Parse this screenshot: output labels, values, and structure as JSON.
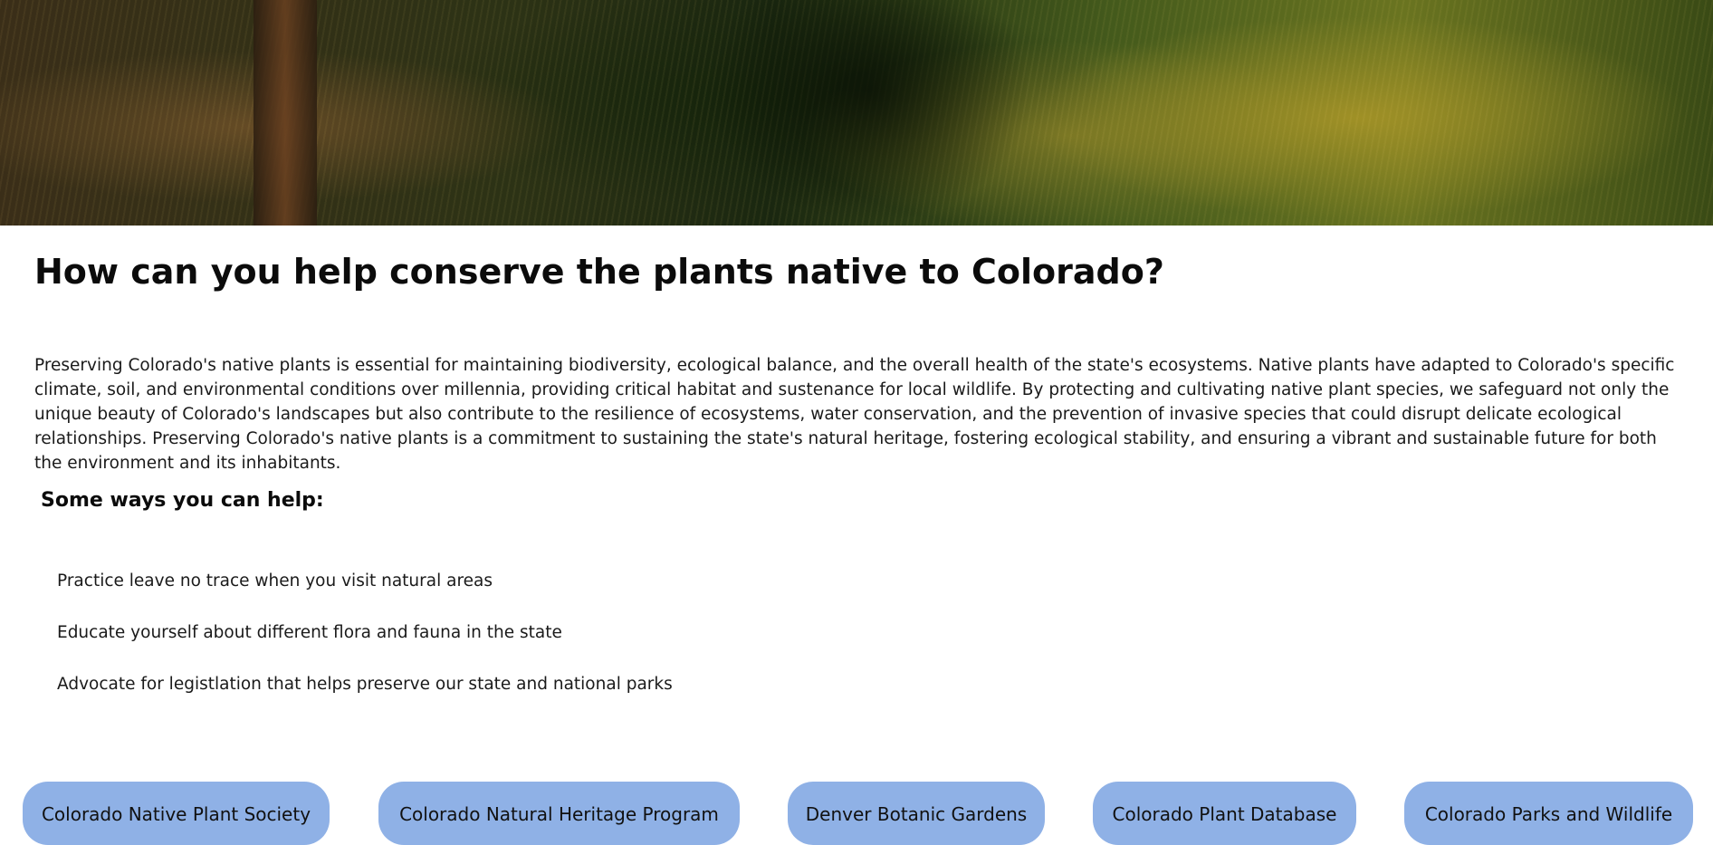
{
  "hero": {
    "image_alt": "Sunlit meadow with trees and grasses"
  },
  "main": {
    "title": "How can you help conserve the plants native to Colorado?",
    "intro": "Preserving Colorado's native plants is essential for maintaining biodiversity, ecological balance, and the overall health of the state's ecosystems. Native plants have adapted to Colorado's specific climate, soil, and environmental conditions over millennia, providing critical habitat and sustenance for local wildlife. By protecting and cultivating native plant species, we safeguard not only the unique beauty of Colorado's landscapes but also contribute to the resilience of ecosystems, water conservation, and the prevention of invasive species that could disrupt delicate ecological relationships. Preserving Colorado's native plants is a commitment to sustaining the state's natural heritage, fostering ecological stability, and ensuring a vibrant and sustainable future for both the environment and its inhabitants.",
    "subtitle": "Some ways you can help:",
    "help_items": [
      "Practice leave no trace when you visit natural areas",
      "Educate yourself about different flora and fauna in the state",
      "Advocate for legistlation that helps preserve our state and national parks"
    ]
  },
  "links": [
    {
      "label": "Colorado Native Plant Society"
    },
    {
      "label": "Colorado Natural Heritage Program"
    },
    {
      "label": "Denver Botanic Gardens"
    },
    {
      "label": "Colorado Plant Database"
    },
    {
      "label": "Colorado Parks and Wildlife"
    }
  ],
  "colors": {
    "link_button_bg": "#8fb1e6",
    "text": "#111111"
  }
}
